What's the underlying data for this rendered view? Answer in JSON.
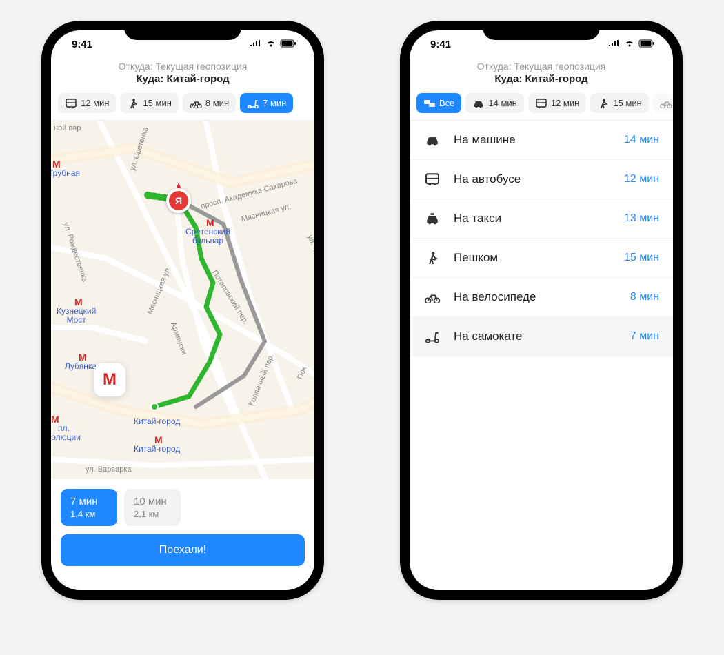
{
  "status": {
    "time": "9:41"
  },
  "header": {
    "from": "Откуда: Текущая геопозиция",
    "to": "Куда: Китай-город"
  },
  "phone1": {
    "tabs": [
      {
        "icon": "bus",
        "label": "12 мин"
      },
      {
        "icon": "walk",
        "label": "15 мин"
      },
      {
        "icon": "bike",
        "label": "8 мин"
      },
      {
        "icon": "scooter",
        "label": "7 мин",
        "active": true
      }
    ],
    "map": {
      "streets": {
        "trubnaya": "Трубная",
        "sretenka": "ул. Сретенка",
        "sakharova": "просп. Академика Сахарова",
        "myasnits1": "Мясницкая ул.",
        "myasnits2": "Мясницкая ул.",
        "potapov": "Потаповский пер.",
        "armyan": "Армянски",
        "kolpach": "Колпачный пер.",
        "rozhdest": "ул. Рождественка",
        "noi_var": "ной вар",
        "pokrovsky": "Пок",
        "varvarka": "ул. Варварка",
        "ulcha": "ул. Ча"
      },
      "metro": {
        "trubnaya": "Трубная",
        "kuznetsky": "Кузнецкий\nМост",
        "lubyanka": "Лубянка",
        "revolution": "пл.\nволюции",
        "kitay1": "Китай-город",
        "kitay2": "Китай-город",
        "sretensky": "Сретенский\nбульвар"
      },
      "current_pos_letter": "Я",
      "metro_card": "М"
    },
    "route_options": [
      {
        "time": "7 мин",
        "dist": "1,4 км",
        "active": true
      },
      {
        "time": "10 мин",
        "dist": "2,1 км"
      }
    ],
    "go_button": "Поехали!"
  },
  "phone2": {
    "tabs": [
      {
        "icon": "all",
        "label": "Все",
        "active": true
      },
      {
        "icon": "car",
        "label": "14 мин"
      },
      {
        "icon": "bus",
        "label": "12 мин"
      },
      {
        "icon": "walk",
        "label": "15 мин"
      },
      {
        "icon": "bike",
        "label": "",
        "faded": true
      }
    ],
    "modes": [
      {
        "icon": "car",
        "label": "На машине",
        "time": "14 мин"
      },
      {
        "icon": "bus",
        "label": "На автобусе",
        "time": "12 мин"
      },
      {
        "icon": "taxi",
        "label": "На такси",
        "time": "13 мин"
      },
      {
        "icon": "walk",
        "label": "Пешком",
        "time": "15 мин"
      },
      {
        "icon": "bike",
        "label": "На велосипеде",
        "time": "8 мин"
      },
      {
        "icon": "scooter",
        "label": "На самокате",
        "time": "7 мин",
        "selected": true
      }
    ]
  }
}
